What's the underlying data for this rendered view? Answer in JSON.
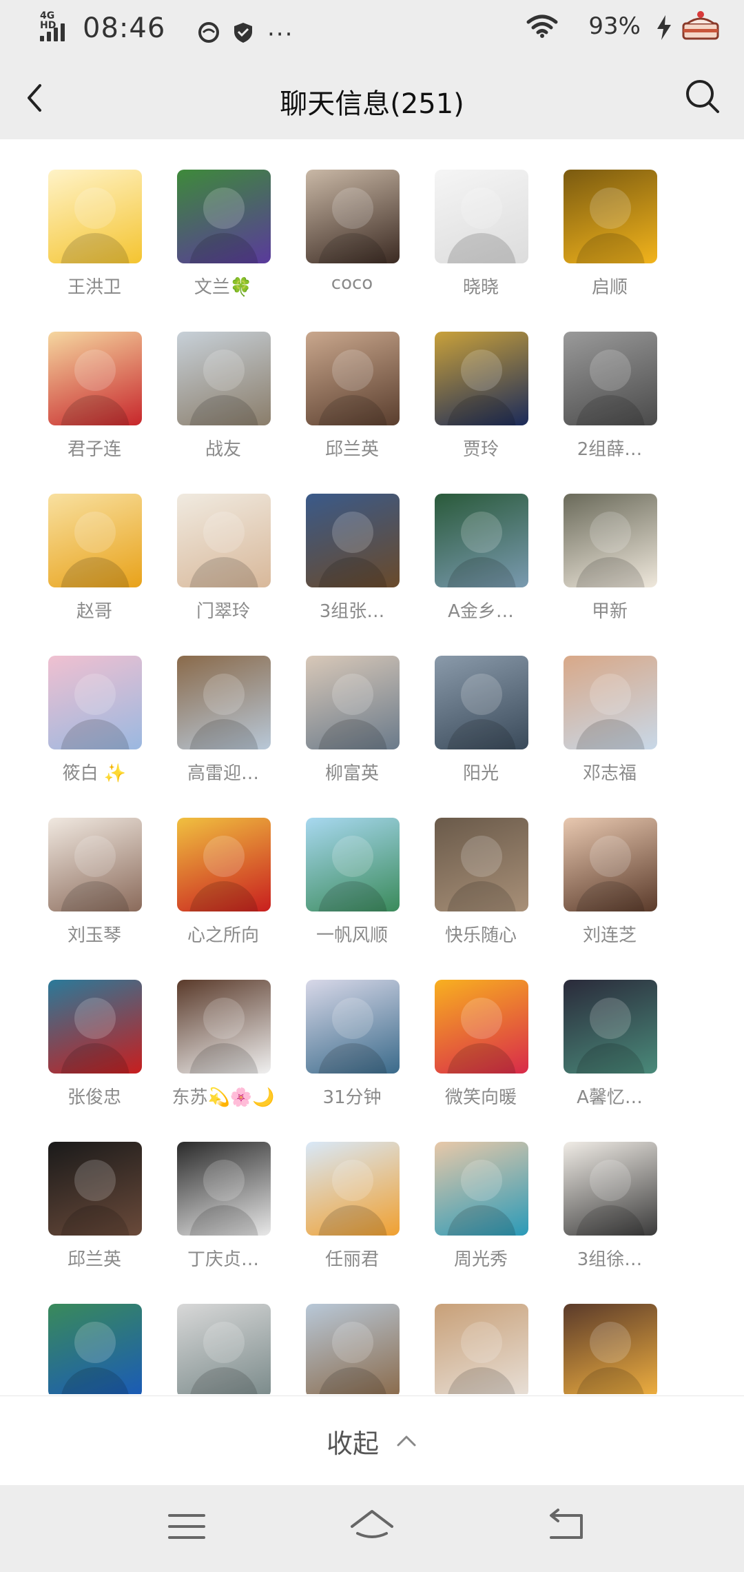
{
  "status": {
    "network": "4G HD",
    "time": "08:46",
    "battery": "93%",
    "more": "···"
  },
  "header": {
    "title": "聊天信息(251)"
  },
  "members": [
    {
      "name": "王洪卫",
      "colors": [
        "#f4c430",
        "#fff3c8"
      ]
    },
    {
      "name": "文兰🍀",
      "colors": [
        "#5a3a9c",
        "#3e8a3a"
      ]
    },
    {
      "name": "coco",
      "colors": [
        "#3b2a22",
        "#c9b8a6"
      ]
    },
    {
      "name": "晓晓",
      "colors": [
        "#dcdcdc",
        "#f5f5f5"
      ]
    },
    {
      "name": "启顺",
      "colors": [
        "#f2b41c",
        "#7a5a10"
      ]
    },
    {
      "name": "君子连",
      "colors": [
        "#c7262b",
        "#f5d7a0"
      ]
    },
    {
      "name": "战友",
      "colors": [
        "#8a7d6a",
        "#c7d0d8"
      ]
    },
    {
      "name": "邱兰英",
      "colors": [
        "#5a3e2e",
        "#c9a78d"
      ]
    },
    {
      "name": "贾玲",
      "colors": [
        "#1a2a5a",
        "#c9a13a"
      ]
    },
    {
      "name": "2组薛…",
      "colors": [
        "#4a4a4a",
        "#9a9a9a"
      ]
    },
    {
      "name": "赵哥",
      "colors": [
        "#e8a21a",
        "#f8e0a0"
      ]
    },
    {
      "name": "门翠玲",
      "colors": [
        "#d8b89a",
        "#f0eae0"
      ]
    },
    {
      "name": "3组张…",
      "colors": [
        "#6a4a2a",
        "#3a5a8a"
      ]
    },
    {
      "name": "A金乡…",
      "colors": [
        "#7a9ab0",
        "#2a5a3a"
      ]
    },
    {
      "name": "甲新",
      "colors": [
        "#efe8dc",
        "#6a6a5a"
      ]
    },
    {
      "name": "筱白 ✨",
      "colors": [
        "#9ab8e0",
        "#f0c0d0"
      ]
    },
    {
      "name": "高雷迎…",
      "colors": [
        "#b8c8d8",
        "#8a6a4a"
      ]
    },
    {
      "name": "柳富英",
      "colors": [
        "#6a7a8a",
        "#d8c8b8"
      ]
    },
    {
      "name": "阳光",
      "colors": [
        "#3a4a5a",
        "#8a9aaa"
      ]
    },
    {
      "name": "邓志福",
      "colors": [
        "#c8d8e8",
        "#d8a888"
      ]
    },
    {
      "name": "刘玉琴",
      "colors": [
        "#8a6a5a",
        "#f0e8e0"
      ]
    },
    {
      "name": "心之所向",
      "colors": [
        "#c81e1e",
        "#f0c040"
      ]
    },
    {
      "name": "一帆风顺",
      "colors": [
        "#3a8a5a",
        "#a8d8f0"
      ]
    },
    {
      "name": "快乐随心",
      "colors": [
        "#a89078",
        "#6a5a4a"
      ]
    },
    {
      "name": "刘连芝",
      "colors": [
        "#5a3a2a",
        "#e8c8b0"
      ]
    },
    {
      "name": "张俊忠",
      "colors": [
        "#c81e1e",
        "#2a7a9a"
      ]
    },
    {
      "name": "东苏💫🌸🌙",
      "colors": [
        "#f0f0f0",
        "#5a3a2a"
      ]
    },
    {
      "name": "31分钟",
      "colors": [
        "#3a6a8a",
        "#d8d8e8"
      ]
    },
    {
      "name": "微笑向暖",
      "colors": [
        "#d82a4a",
        "#f8b020"
      ]
    },
    {
      "name": "A馨忆…",
      "colors": [
        "#4a8a7a",
        "#2a2a3a"
      ]
    },
    {
      "name": "邱兰英",
      "colors": [
        "#6a4a3a",
        "#1a1a1a"
      ]
    },
    {
      "name": "丁庆贞…",
      "colors": [
        "#e8e8e8",
        "#2a2a2a"
      ]
    },
    {
      "name": "任丽君",
      "colors": [
        "#f0a030",
        "#d8e8f8"
      ]
    },
    {
      "name": "周光秀",
      "colors": [
        "#2a9ab8",
        "#e8c8a8"
      ]
    },
    {
      "name": "3组徐…",
      "colors": [
        "#3a3a3a",
        "#f0ece6"
      ]
    },
    {
      "name": "",
      "colors": [
        "#1a5ab8",
        "#3a8a5a"
      ]
    },
    {
      "name": "",
      "colors": [
        "#7a8a8a",
        "#d8d8d8"
      ]
    },
    {
      "name": "",
      "colors": [
        "#8a6a4a",
        "#b8c8d8"
      ]
    },
    {
      "name": "",
      "colors": [
        "#e8e0d8",
        "#c8a078"
      ]
    },
    {
      "name": "",
      "colors": [
        "#f0b040",
        "#5a3a2a"
      ]
    }
  ],
  "collapse": {
    "label": "收起"
  },
  "nav": {
    "menu_icon": "menu-icon",
    "home_icon": "home-icon",
    "back_icon": "back-icon"
  }
}
